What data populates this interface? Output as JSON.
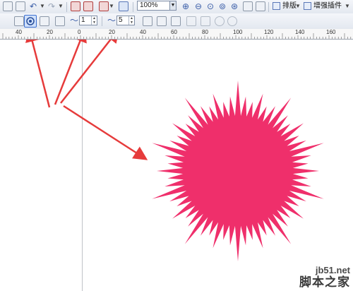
{
  "toolbar": {
    "zoom_value": "100%",
    "layout_button": "排版",
    "plugin_button": "增强插件"
  },
  "property_bar": {
    "spin1_value": "1",
    "spin2_value": "5"
  },
  "ruler": {
    "labels": [
      "40",
      "20",
      "0",
      "20",
      "40",
      "60",
      "80",
      "100",
      "120",
      "140",
      "160"
    ]
  },
  "watermark": {
    "url": "jb51.net",
    "name": "脚本之家"
  },
  "colors": {
    "star_fill": "#ef2f6b",
    "annotation_arrow": "#e63b3b"
  }
}
